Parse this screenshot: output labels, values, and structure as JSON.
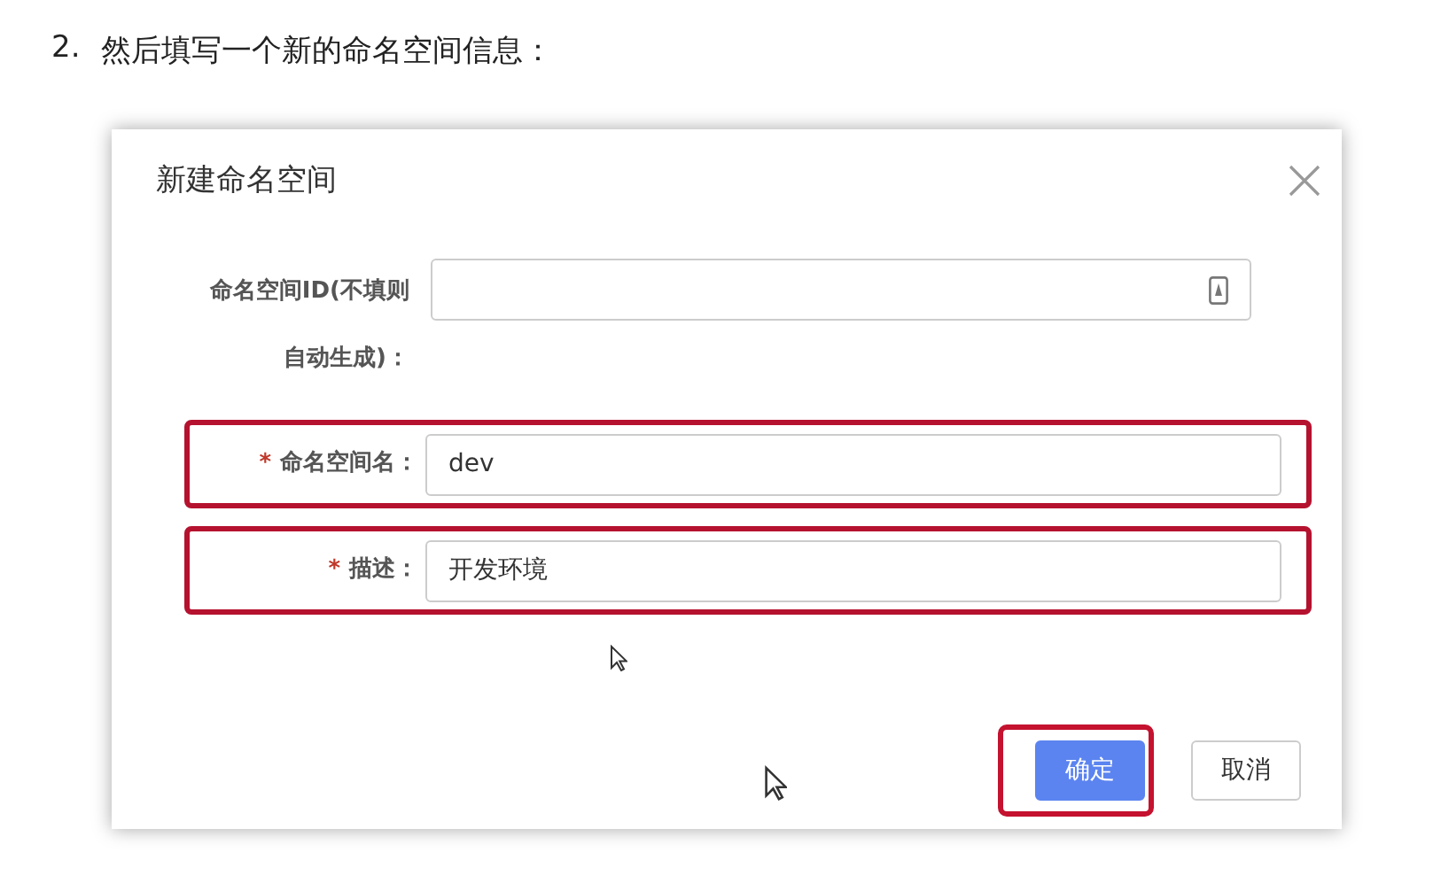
{
  "step": {
    "number": "2.",
    "text": "然后填写一个新的命名空间信息："
  },
  "dialog": {
    "title": "新建命名空间",
    "fields": [
      {
        "label": "命名空间ID(不填则自动生成)：",
        "highlighted": false,
        "kind": "id"
      },
      {
        "required_mark": "*",
        "label": "命名空间名：",
        "value": "dev",
        "highlighted": true,
        "kind": "text"
      },
      {
        "required_mark": "*",
        "label": "描述：",
        "value": "开发环境",
        "highlighted": true,
        "kind": "text"
      }
    ],
    "buttons": [
      {
        "label": "确定",
        "kind": "primary",
        "highlighted": true
      },
      {
        "label": "取消",
        "kind": "default",
        "highlighted": false
      }
    ]
  }
}
